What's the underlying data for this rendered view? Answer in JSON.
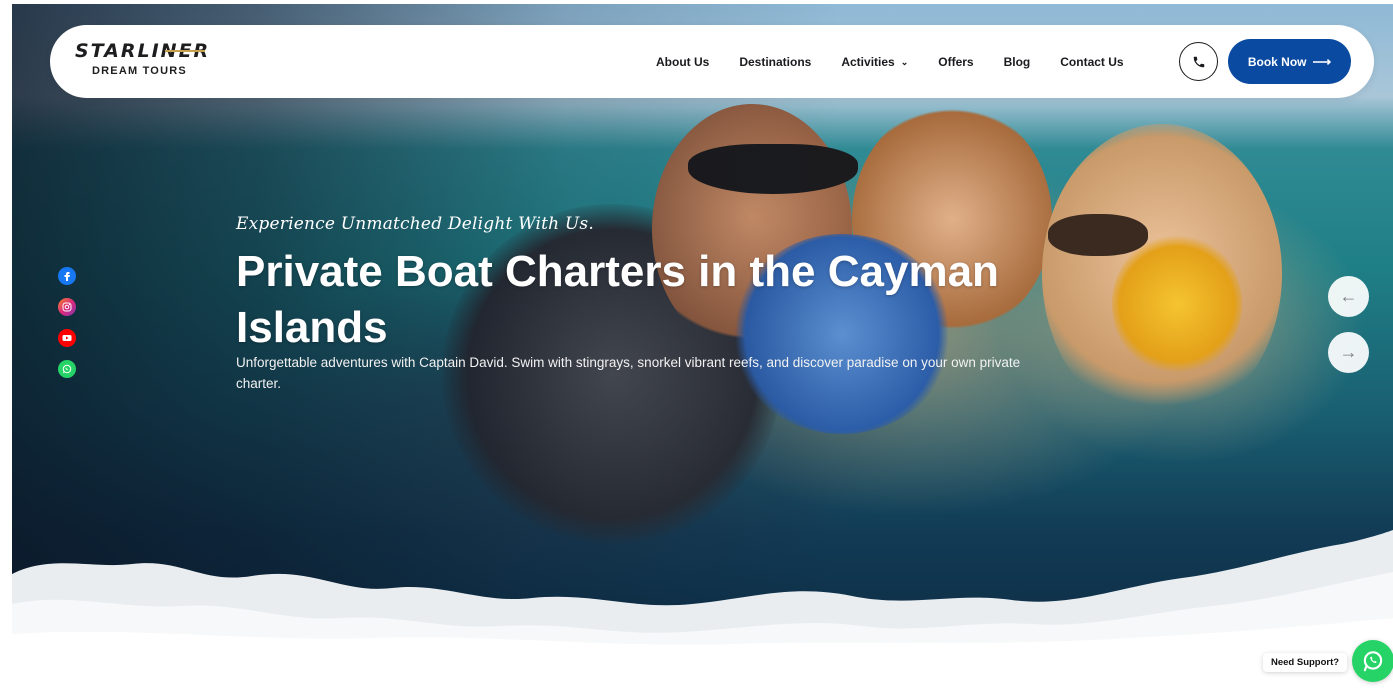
{
  "brand": {
    "logo_main": "STARLINER",
    "logo_sub": "DREAM TOURS"
  },
  "nav": {
    "items": [
      {
        "label": "About Us",
        "has_dropdown": false
      },
      {
        "label": "Destinations",
        "has_dropdown": false
      },
      {
        "label": "Activities",
        "has_dropdown": true
      },
      {
        "label": "Offers",
        "has_dropdown": false
      },
      {
        "label": "Blog",
        "has_dropdown": false
      },
      {
        "label": "Contact Us",
        "has_dropdown": false
      }
    ],
    "phone_icon": "phone-icon",
    "cta_label": "Book Now",
    "cta_icon": "arrow-right-icon"
  },
  "hero": {
    "tagline": "Experience Unmatched Delight With Us.",
    "headline": "Private Boat Charters in the Cayman Islands",
    "subtext": "Unforgettable adventures with Captain David. Swim with stingrays, snorkel vibrant reefs, and discover paradise on your own private charter."
  },
  "social": [
    {
      "icon": "facebook-icon",
      "color": "#1877f2"
    },
    {
      "icon": "instagram-icon",
      "color": "#e1306c"
    },
    {
      "icon": "youtube-icon",
      "color": "#ff0000"
    },
    {
      "icon": "whatsapp-icon",
      "color": "#25d366"
    }
  ],
  "slider": {
    "prev_icon": "arrow-left-icon",
    "next_icon": "arrow-right-icon"
  },
  "support": {
    "label": "Need Support?",
    "icon": "whatsapp-icon"
  },
  "colors": {
    "cta_bg": "#0a4aa0",
    "whatsapp": "#25d366"
  }
}
